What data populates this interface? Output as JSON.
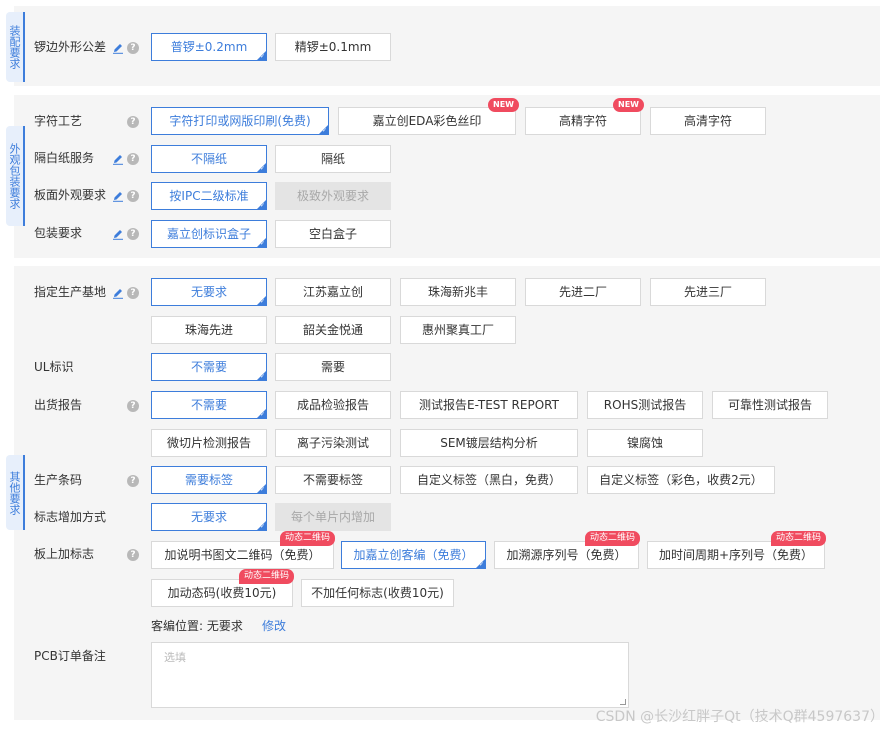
{
  "sections": {
    "assembly": "装配要求",
    "appearance": "外观包装要求",
    "other": "其他要求"
  },
  "rows": {
    "edge_tolerance": {
      "label": "锣边外形公差",
      "options": [
        "普锣±0.2mm",
        "精锣±0.1mm"
      ]
    },
    "char_process": {
      "label": "字符工艺",
      "options": [
        "字符打印或网版印刷(免费)",
        "嘉立创EDA彩色丝印",
        "高精字符",
        "高清字符"
      ],
      "badge": "NEW"
    },
    "separator": {
      "label": "隔白纸服务",
      "options": [
        "不隔纸",
        "隔纸"
      ]
    },
    "board_appearance": {
      "label": "板面外观要求",
      "options": [
        "按IPC二级标准",
        "极致外观要求"
      ]
    },
    "packaging": {
      "label": "包装要求",
      "options": [
        "嘉立创标识盒子",
        "空白盒子"
      ]
    },
    "factory": {
      "label": "指定生产基地",
      "options": [
        "无要求",
        "江苏嘉立创",
        "珠海新兆丰",
        "先进二厂",
        "先进三厂",
        "珠海先进",
        "韶关金悦通",
        "惠州聚真工厂"
      ]
    },
    "ul": {
      "label": "UL标识",
      "options": [
        "不需要",
        "需要"
      ]
    },
    "report": {
      "label": "出货报告",
      "options": [
        "不需要",
        "成品检验报告",
        "测试报告E-TEST REPORT",
        "ROHS测试报告",
        "可靠性测试报告",
        "微切片检测报告",
        "离子污染测试",
        "SEM镀层结构分析",
        "镍腐蚀"
      ]
    },
    "barcode": {
      "label": "生产条码",
      "options": [
        "需要标签",
        "不需要标签",
        "自定义标签（黑白，免费）",
        "自定义标签（彩色，收费2元）"
      ]
    },
    "mark_method": {
      "label": "标志增加方式",
      "options": [
        "无要求",
        "每个单片内增加"
      ]
    },
    "board_mark": {
      "label": "板上加标志",
      "options": [
        "加说明书图文二维码（免费）",
        "加嘉立创客编（免费）",
        "加溯源序列号（免费）",
        "加时间周期+序列号（免费）",
        "加动态码(收费10元)",
        "不加任何标志(收费10元)"
      ],
      "badge": "动态二维码"
    },
    "customer_code": {
      "label": "客编位置:",
      "value": "无要求",
      "link": "修改"
    },
    "pcb_note": {
      "label": "PCB订单备注",
      "placeholder": "选填"
    }
  },
  "watermark": "CSDN @长沙红胖子Qt（技术Q群4597637）",
  "colors": {
    "accent": "#3d7ddb",
    "badge": "#f04b5f",
    "section_bg": "#f5f5f5",
    "disabled": "#e4e4e4"
  }
}
